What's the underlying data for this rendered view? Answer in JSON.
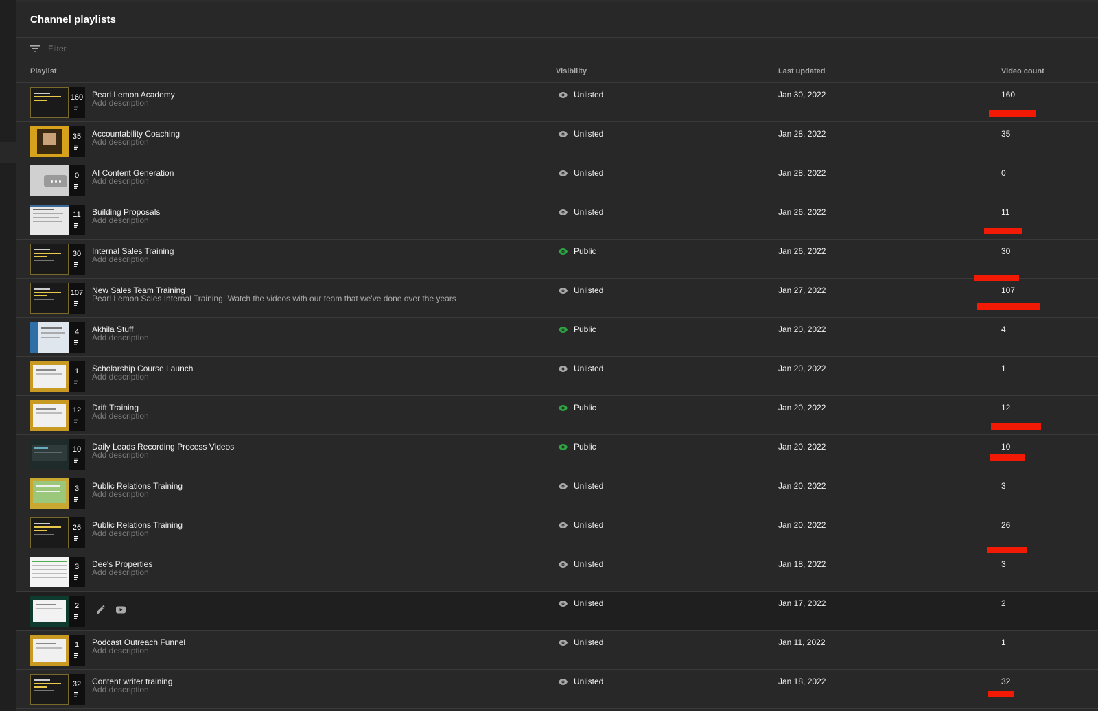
{
  "page": {
    "title": "Channel playlists",
    "filter_placeholder": "Filter"
  },
  "columns": {
    "playlist": "Playlist",
    "visibility": "Visibility",
    "last_updated": "Last updated",
    "video_count": "Video count"
  },
  "colors": {
    "public_eye": "#2ba640",
    "unlisted_eye": "#aaaaaa",
    "redaction": "#f21a04"
  },
  "playlists": [
    {
      "title": "Pearl Lemon Academy",
      "description": "Add description",
      "visibility": "Unlisted",
      "last_updated": "Jan 30, 2022",
      "video_count": "160",
      "thumb_count": "160",
      "thumb_icon": "dark-title-card"
    },
    {
      "title": "Accountability Coaching",
      "description": "Add description",
      "visibility": "Unlisted",
      "last_updated": "Jan 28, 2022",
      "video_count": "35",
      "thumb_count": "35",
      "thumb_icon": "yellow-photo"
    },
    {
      "title": "AI Content Generation",
      "description": "Add description",
      "visibility": "Unlisted",
      "last_updated": "Jan 28, 2022",
      "video_count": "0",
      "thumb_count": "0",
      "thumb_icon": "empty-placeholder"
    },
    {
      "title": "Building Proposals",
      "description": "Add description",
      "visibility": "Unlisted",
      "last_updated": "Jan 26, 2022",
      "video_count": "11",
      "thumb_count": "11",
      "thumb_icon": "document-screen"
    },
    {
      "title": "Internal Sales Training",
      "description": "Add description",
      "visibility": "Public",
      "last_updated": "Jan 26, 2022",
      "video_count": "30",
      "thumb_count": "30",
      "thumb_icon": "dark-title-card"
    },
    {
      "title": "New Sales Team Training",
      "description": "Pearl Lemon Sales Internal Training. Watch the videos with our team that we've done over the years",
      "visibility": "Unlisted",
      "last_updated": "Jan 27, 2022",
      "video_count": "107",
      "thumb_count": "107",
      "thumb_icon": "dark-title-card"
    },
    {
      "title": "Akhila Stuff",
      "description": "Add description",
      "visibility": "Public",
      "last_updated": "Jan 20, 2022",
      "video_count": "4",
      "thumb_count": "4",
      "thumb_icon": "blue-screen"
    },
    {
      "title": "Scholarship Course Launch",
      "description": "Add description",
      "visibility": "Unlisted",
      "last_updated": "Jan 20, 2022",
      "video_count": "1",
      "thumb_count": "1",
      "thumb_icon": "gold-document"
    },
    {
      "title": "Drift Training",
      "description": "Add description",
      "visibility": "Public",
      "last_updated": "Jan 20, 2022",
      "video_count": "12",
      "thumb_count": "12",
      "thumb_icon": "gold-document"
    },
    {
      "title": "Daily Leads Recording Process Videos",
      "description": "Add description",
      "visibility": "Public",
      "last_updated": "Jan 20, 2022",
      "video_count": "10",
      "thumb_count": "10",
      "thumb_icon": "dashboard-screen"
    },
    {
      "title": "Public Relations Training",
      "description": "Add description",
      "visibility": "Unlisted",
      "last_updated": "Jan 20, 2022",
      "video_count": "3",
      "thumb_count": "3",
      "thumb_icon": "green-grid"
    },
    {
      "title": "Public Relations Training",
      "description": "Add description",
      "visibility": "Unlisted",
      "last_updated": "Jan 20, 2022",
      "video_count": "26",
      "thumb_count": "26",
      "thumb_icon": "dark-title-card"
    },
    {
      "title": "Dee's Properties",
      "description": "Add description",
      "visibility": "Unlisted",
      "last_updated": "Jan 18, 2022",
      "video_count": "3",
      "thumb_count": "3",
      "thumb_icon": "spreadsheet"
    },
    {
      "title": "",
      "description": "",
      "visibility": "Unlisted",
      "last_updated": "Jan 17, 2022",
      "video_count": "2",
      "thumb_count": "2",
      "thumb_icon": "green-document",
      "hovered": true,
      "actions": [
        "pencil-icon",
        "youtube-icon"
      ]
    },
    {
      "title": "Podcast Outreach Funnel",
      "description": "Add description",
      "visibility": "Unlisted",
      "last_updated": "Jan 11, 2022",
      "video_count": "1",
      "thumb_count": "1",
      "thumb_icon": "gold-document"
    },
    {
      "title": "Content writer training",
      "description": "Add description",
      "visibility": "Unlisted",
      "last_updated": "Jan 18, 2022",
      "video_count": "32",
      "thumb_count": "32",
      "thumb_icon": "dark-title-card"
    }
  ]
}
